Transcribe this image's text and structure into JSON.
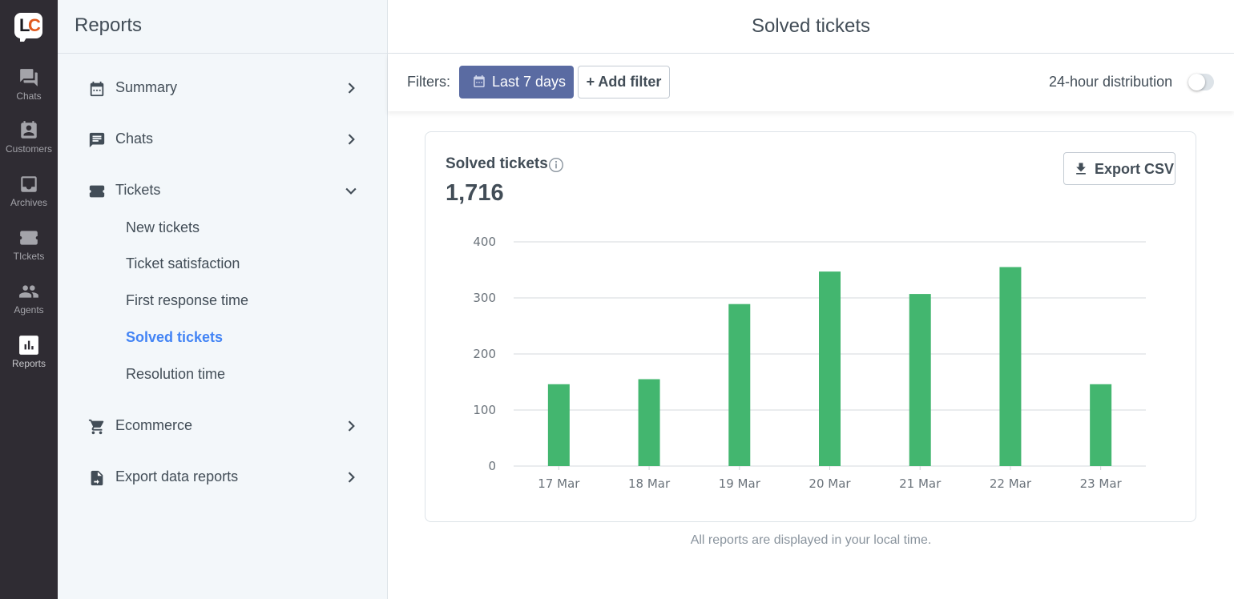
{
  "rail": {
    "logo": {
      "letter1": "L",
      "letter2": "C"
    },
    "items": [
      {
        "label": "Chats",
        "icon": "chats-icon"
      },
      {
        "label": "Customers",
        "icon": "customers-icon"
      },
      {
        "label": "Archives",
        "icon": "archives-icon"
      },
      {
        "label": "TIckets",
        "icon": "tickets-icon"
      },
      {
        "label": "Agents",
        "icon": "agents-icon"
      },
      {
        "label": "Reports",
        "icon": "reports-icon",
        "active": true
      }
    ]
  },
  "sidebar": {
    "title": "Reports",
    "groups": [
      {
        "label": "Summary",
        "icon": "calendar-icon",
        "expanded": false
      },
      {
        "label": "Chats",
        "icon": "chat-message-icon",
        "expanded": false
      },
      {
        "label": "Tickets",
        "icon": "ticket-icon",
        "expanded": true,
        "items": [
          {
            "label": "New tickets"
          },
          {
            "label": "Ticket satisfaction"
          },
          {
            "label": "First response time"
          },
          {
            "label": "Solved tickets",
            "active": true
          },
          {
            "label": "Resolution time"
          }
        ]
      },
      {
        "label": "Ecommerce",
        "icon": "cart-icon",
        "expanded": false
      },
      {
        "label": "Export data reports",
        "icon": "export-file-icon",
        "expanded": false
      }
    ]
  },
  "header": {
    "title": "Solved tickets"
  },
  "filters": {
    "label": "Filters:",
    "date_filter": "Last 7 days",
    "add_filter": "+ Add filter",
    "distribution_label": "24-hour distribution",
    "distribution_enabled": false
  },
  "card": {
    "title": "Solved tickets",
    "total": "1,716",
    "export_label": "Export CSV"
  },
  "colors": {
    "bar": "#43b66f",
    "accent": "#4384f5",
    "date_button": "#5a6ba2"
  },
  "chart_data": {
    "type": "bar",
    "title": "Solved tickets",
    "categories": [
      "17 Mar",
      "18 Mar",
      "19 Mar",
      "20 Mar",
      "21 Mar",
      "22 Mar",
      "23 Mar"
    ],
    "values": [
      146,
      155,
      289,
      347,
      307,
      355,
      146
    ],
    "yticks": [
      "0",
      "100",
      "200",
      "300",
      "400"
    ],
    "ylim": [
      0,
      400
    ],
    "xlabel": "",
    "ylabel": "",
    "grid": true,
    "legend": "none"
  },
  "footnote": "All reports are displayed in your local time."
}
